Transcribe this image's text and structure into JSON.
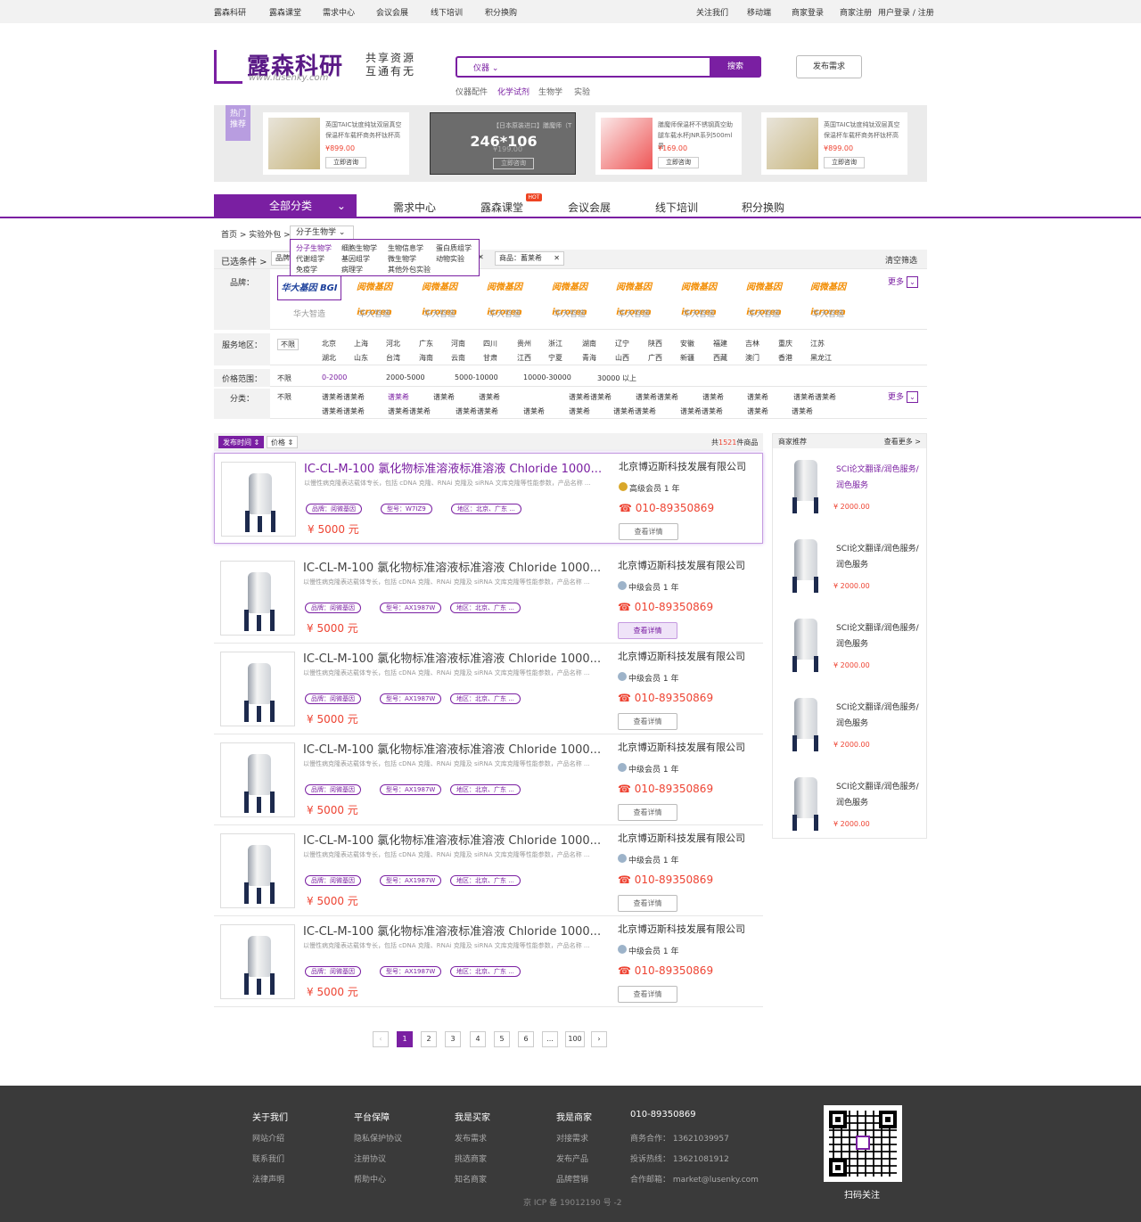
{
  "topbar": {
    "left": [
      "露森科研",
      "露森课堂",
      "需求中心",
      "会议会展",
      "线下培训",
      "积分换购"
    ],
    "right": [
      "关注我们",
      "移动端",
      "商家登录",
      "商家注册",
      "用户登录 / 注册"
    ]
  },
  "header": {
    "logo_cn": "露森科研",
    "logo_en": "www.lusenky.com",
    "slogan": [
      "共享资源",
      "互通有无"
    ],
    "search_category": "仪器",
    "search_placeholder": "",
    "search_button": "搜索",
    "hot_words": [
      "仪器配件",
      "化学试剂",
      "生物学",
      "实验"
    ],
    "post_button": "发布需求"
  },
  "hot": {
    "tag": [
      "热门",
      "推荐"
    ],
    "cards": [
      {
        "title": "英国TAIC钛度纯钛双层真空保温杯车载杯商务杯钛杯高",
        "price": "¥899.00",
        "button": "立即咨询"
      },
      {
        "title": "【日本原装进口】膳魔师（T",
        "overlay": "246*106",
        "price": "¥199.00",
        "button": "立即咨询"
      },
      {
        "title": "膳魔师保温杯不锈钢真空助腿车载水杯JNR系列500ml男",
        "price": "¥169.00",
        "button": "立即咨询"
      },
      {
        "title": "英国TAIC钛度纯钛双层真空保温杯车载杯商务杯钛杯高",
        "price": "¥899.00",
        "button": "立即咨询"
      }
    ]
  },
  "nav": {
    "all": "全部分类",
    "items": [
      "需求中心",
      "露森课堂",
      "会议会展",
      "线下培训",
      "积分换购"
    ],
    "hot_badge": "HOT"
  },
  "breadcrumb": {
    "path": "首页 > 实验外包 >",
    "select": "分子生物学",
    "dropdown": [
      "分子生物学",
      "细胞生物学",
      "生物信息学",
      "蛋白质组学",
      "代谢组学",
      "基因组学",
      "微生物学",
      "动物实验",
      "免疫学",
      "病理学",
      "其他外包实验"
    ]
  },
  "filter": {
    "selected_label": "已选条件 >",
    "chips": [
      "品牌",
      "商品：蓄莱希"
    ],
    "clear": "清空筛选",
    "brand_label": "品牌：",
    "brands": [
      {
        "logo": "华大基因 BGI",
        "name": "华大智造"
      },
      {
        "logo": "阅微基因 icrorea",
        "name": "华大智造"
      },
      {
        "logo": "阅微基因 icrorea",
        "name": "华大智造"
      },
      {
        "logo": "阅微基因 icrorea",
        "name": "华大智造"
      },
      {
        "logo": "阅微基因 icrorea",
        "name": "华大智造"
      },
      {
        "logo": "阅微基因 icrorea",
        "name": "华大智造"
      },
      {
        "logo": "阅微基因 icrorea",
        "name": "华大智造"
      },
      {
        "logo": "阅微基因 icrorea",
        "name": "华大智造"
      },
      {
        "logo": "阅微基因 icrorea",
        "name": "华大智造"
      }
    ],
    "more": "更多",
    "region_label": "服务地区：",
    "regions_row1": [
      "不限",
      "北京",
      "上海",
      "河北",
      "广东",
      "河南",
      "四川",
      "贵州",
      "浙江",
      "湖南",
      "辽宁",
      "陕西",
      "安徽",
      "福建",
      "吉林",
      "重庆",
      "江苏"
    ],
    "regions_row2": [
      "湖北",
      "山东",
      "台湾",
      "海南",
      "云南",
      "甘肃",
      "江西",
      "宁夏",
      "青海",
      "山西",
      "广西",
      "新疆",
      "西藏",
      "澳门",
      "香港",
      "黑龙江"
    ],
    "price_label": "价格范围：",
    "prices": [
      "不限",
      "0-2000",
      "2000-5000",
      "5000-10000",
      "10000-30000",
      "30000 以上"
    ],
    "cat_label": "分类：",
    "cats_row1": [
      "不限",
      "谱莱希谱莱希",
      "谱莱希",
      "谱莱希",
      "谱莱希",
      "谱莱希谱莱希",
      "谱莱希谱莱希",
      "谱莱希",
      "谱莱希",
      "谱莱希谱莱希"
    ],
    "cats_row2": [
      "谱莱希谱莱希",
      "谱莱希谱莱希",
      "谱莱希谱莱希",
      "谱莱希",
      "谱莱希",
      "谱莱希谱莱希",
      "谱莱希谱莱希",
      "谱莱希",
      "谱莱希"
    ]
  },
  "sort": {
    "time": "发布时间 ⇕",
    "price": "价格 ⇕",
    "total_prefix": "共",
    "total": "1521",
    "total_suffix": "件商品"
  },
  "products": [
    {
      "title": "IC-CL-M-100 氯化物标准溶液标准溶液 Chloride 1000...",
      "desc": "以慢性病克隆表达载体专长，包括 cDNA 克隆、RNAi 克隆及 siRNA 文库克隆等性能参数，产品名称 ...",
      "brand": "品牌：阅微基因",
      "model": "型号：W7IZ9",
      "region": "地区：北京、广东 ...",
      "price": "¥ 5000 元",
      "company": "北京博迈斯科技发展有限公司",
      "member": "高级会员  1 年",
      "phone": "☎ 010-89350869",
      "detail": "查看详情"
    },
    {
      "title": "IC-CL-M-100 氯化物标准溶液标准溶液 Chloride 1000...",
      "desc": "以慢性病克隆表达载体专长，包括 cDNA 克隆、RNAi 克隆及 siRNA 文库克隆等性能参数，产品名称 ...",
      "brand": "品牌：阅微基因",
      "model": "型号：AX1987W",
      "region": "地区：北京、广东 ...",
      "price": "¥ 5000 元",
      "company": "北京博迈斯科技发展有限公司",
      "member": "中级会员  1 年",
      "phone": "☎ 010-89350869",
      "detail": "查看详情"
    },
    {
      "title": "IC-CL-M-100 氯化物标准溶液标准溶液 Chloride 1000...",
      "desc": "以慢性病克隆表达载体专长，包括 cDNA 克隆、RNAi 克隆及 siRNA 文库克隆等性能参数，产品名称 ...",
      "brand": "品牌：阅微基因",
      "model": "型号：AX1987W",
      "region": "地区：北京、广东 ...",
      "price": "¥ 5000 元",
      "company": "北京博迈斯科技发展有限公司",
      "member": "中级会员  1 年",
      "phone": "☎ 010-89350869",
      "detail": "查看详情"
    },
    {
      "title": "IC-CL-M-100 氯化物标准溶液标准溶液 Chloride 1000...",
      "desc": "以慢性病克隆表达载体专长，包括 cDNA 克隆、RNAi 克隆及 siRNA 文库克隆等性能参数，产品名称 ...",
      "brand": "品牌：阅微基因",
      "model": "型号：AX1987W",
      "region": "地区：北京、广东 ...",
      "price": "¥ 5000 元",
      "company": "北京博迈斯科技发展有限公司",
      "member": "中级会员  1 年",
      "phone": "☎ 010-89350869",
      "detail": "查看详情"
    },
    {
      "title": "IC-CL-M-100 氯化物标准溶液标准溶液 Chloride 1000...",
      "desc": "以慢性病克隆表达载体专长，包括 cDNA 克隆、RNAi 克隆及 siRNA 文库克隆等性能参数，产品名称 ...",
      "brand": "品牌：阅微基因",
      "model": "型号：AX1987W",
      "region": "地区：北京、广东 ...",
      "price": "¥ 5000 元",
      "company": "北京博迈斯科技发展有限公司",
      "member": "中级会员  1 年",
      "phone": "☎ 010-89350869",
      "detail": "查看详情"
    },
    {
      "title": "IC-CL-M-100 氯化物标准溶液标准溶液 Chloride 1000...",
      "desc": "以慢性病克隆表达载体专长，包括 cDNA 克隆、RNAi 克隆及 siRNA 文库克隆等性能参数，产品名称 ...",
      "brand": "品牌：阅微基因",
      "model": "型号：AX1987W",
      "region": "地区：北京、广东 ...",
      "price": "¥ 5000 元",
      "company": "北京博迈斯科技发展有限公司",
      "member": "中级会员  1 年",
      "phone": "☎ 010-89350869",
      "detail": "查看详情"
    }
  ],
  "side": {
    "title": "商家推荐",
    "more": "查看更多 >",
    "items": [
      {
        "title": "SCI论文翻译/润色服务/润色服务",
        "price": "¥ 2000.00"
      },
      {
        "title": "SCI论文翻译/润色服务/润色服务",
        "price": "¥ 2000.00"
      },
      {
        "title": "SCI论文翻译/润色服务/润色服务",
        "price": "¥ 2000.00"
      },
      {
        "title": "SCI论文翻译/润色服务/润色服务",
        "price": "¥ 2000.00"
      },
      {
        "title": "SCI论文翻译/润色服务/润色服务",
        "price": "¥ 2000.00"
      }
    ]
  },
  "pagination": [
    "‹",
    "1",
    "2",
    "3",
    "4",
    "5",
    "6",
    "...",
    "100",
    "›"
  ],
  "footer": {
    "cols": [
      {
        "title": "关于我们",
        "links": [
          "网站介绍",
          "联系我们",
          "法律声明"
        ]
      },
      {
        "title": "平台保障",
        "links": [
          "隐私保护协议",
          "注册协议",
          "帮助中心"
        ]
      },
      {
        "title": "我是买家",
        "links": [
          "发布需求",
          "挑选商家",
          "知名商家"
        ]
      },
      {
        "title": "我是商家",
        "links": [
          "对接需求",
          "发布产品",
          "品牌营销"
        ]
      }
    ],
    "phone": "010-89350869",
    "contacts": [
      "商务合作：  13621039957",
      "投诉热线：  13621081912",
      "合作邮箱：  market@lusenky.com"
    ],
    "qr_caption": "扫码关注",
    "icp": "京 ICP 备 19012190 号 -2"
  },
  "colors": {
    "brand": "#7a1fa2",
    "price": "#e43",
    "footer": "#3a3a3a"
  }
}
